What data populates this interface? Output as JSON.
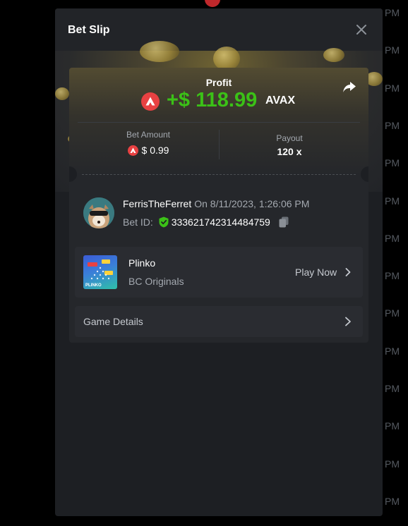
{
  "background": {
    "time_suffix": "PM",
    "pm_count": 14
  },
  "modal": {
    "title": "Bet Slip",
    "close_icon": "close-icon",
    "share_icon": "share-icon"
  },
  "profit": {
    "label": "Profit",
    "value": "+$ 118.99",
    "currency": "AVAX",
    "currency_icon": "avax-icon"
  },
  "stats": {
    "bet_amount_label": "Bet Amount",
    "bet_amount_value": "$ 0.99",
    "payout_label": "Payout",
    "payout_value": "120 x"
  },
  "user": {
    "name": "FerrisTheFerret",
    "datetime": "On 8/11/2023, 1:26:06 PM",
    "bet_id_label": "Bet ID:",
    "bet_id": "333621742314484759"
  },
  "game": {
    "title": "Plinko",
    "provider": "BC Originals",
    "play_label": "Play Now",
    "thumb_text": "PLINKO"
  },
  "details": {
    "label": "Game Details"
  },
  "colors": {
    "profit_green": "#3bc117",
    "avax_red": "#e84142",
    "modal_bg": "#1d1f23",
    "card_bg": "#25272b",
    "row_bg": "#2a2c31"
  }
}
